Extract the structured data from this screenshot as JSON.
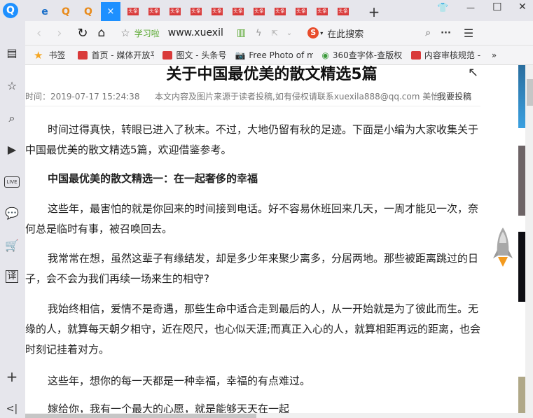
{
  "tabs": {
    "new_tab": "+",
    "tab_label": "头条",
    "close": "×"
  },
  "window": {
    "skin": "👕",
    "minimize": "—",
    "maximize": "☐",
    "close": "✕"
  },
  "toolbar": {
    "site_name": "学习啦",
    "url": "www.xuexil",
    "search_placeholder": "在此搜索"
  },
  "bookmarks": {
    "label": "书签",
    "items": [
      "首页 - 媒体开放平",
      "图文 - 头条号",
      "Free Photo of m",
      "360查字体-查版权",
      "内容审核规范 - "
    ],
    "more": "»"
  },
  "article": {
    "title": "关于中国最优美的散文精选5篇",
    "time": "时间：2019-07-17 15:24:38",
    "source": "本文内容及图片来源于读者投稿,如有侵权请联系xuexila888@qq.com 美怡",
    "submit": "我要投稿",
    "paragraphs": [
      "时间过得真快，转眼已进入了秋末。不过，大地仍留有秋的足迹。下面是小编为大家收集关于中国最优美的散文精选5篇，欢迎借鉴参考。",
      "中国最优美的散文精选一：在一起奢侈的幸福",
      "这些年，最害怕的就是你回来的时间接到电话。好不容易休班回来几天，一周才能见一次，奈何总是临时有事，被召唤回去。",
      "我常常在想，虽然这辈子有缘结发，却是多少年来聚少离多，分居两地。那些被距离跳过的日子，会不会为我们再续一场来生的相守?",
      "我始终相信，爱情不是奇遇，那些生命中适合走到最后的人，从一开始就是为了彼此而生。无缘的人，就算每天朝夕相守，近在咫尺，也心似天涯;而真正入心的人，就算相距再远的距离，也会时刻记挂着对方。",
      "这些年，想你的每一天都是一种幸福，幸福的有点难过。",
      "嫁给你，我有一个最大的心愿，就是能够天天在一起"
    ]
  },
  "sidebar": {
    "live": "LIVE",
    "translate": "译",
    "add": "+",
    "collapse": "<|"
  }
}
